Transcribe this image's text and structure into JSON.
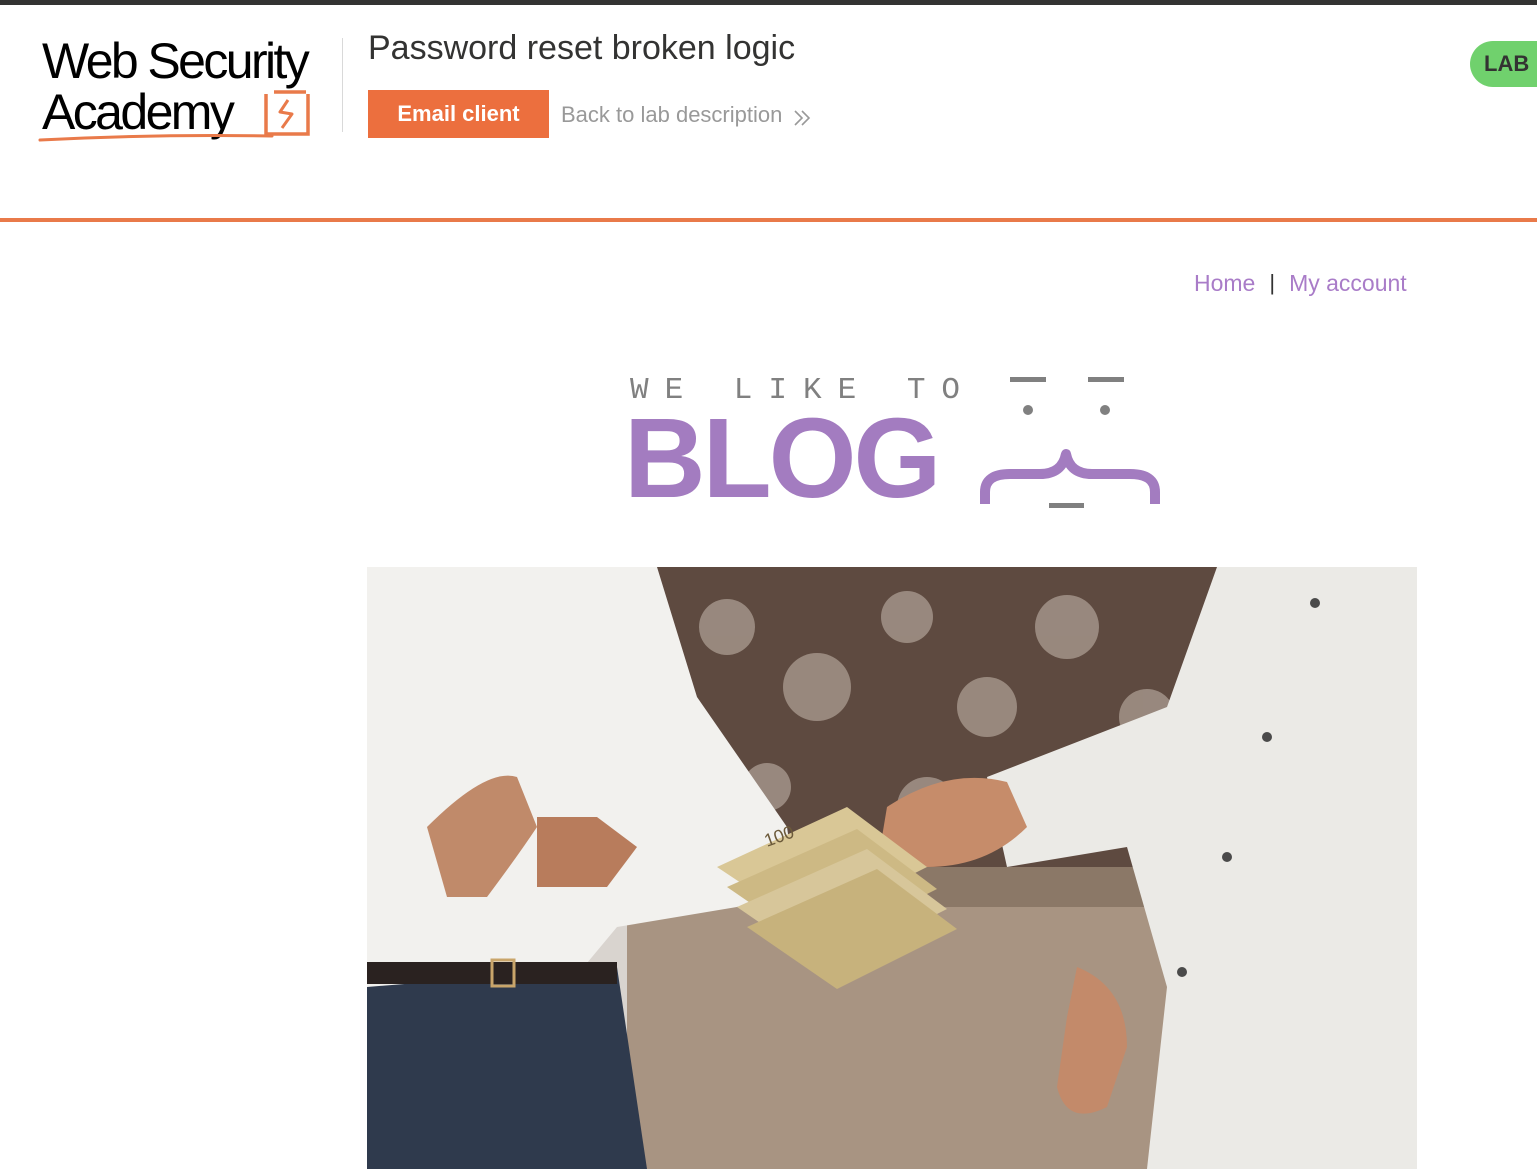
{
  "brand": {
    "line1": "Web Security",
    "line2": "Academy"
  },
  "lab": {
    "title": "Password reset broken logic",
    "email_client_label": "Email client",
    "back_link_label": "Back to lab description",
    "badge_label": "LAB"
  },
  "nav": {
    "home_label": "Home",
    "separator": "|",
    "my_account_label": "My account"
  },
  "blog_banner": {
    "tagline": "WE LIKE TO",
    "word": "BLOG"
  },
  "hero_image": {
    "alt": "Two men in white shirts exchanging a stack of banknotes"
  },
  "colors": {
    "accent_orange": "#ec6f3e",
    "lab_badge_green": "#70d16d",
    "nav_purple": "#a97cc8",
    "blog_purple": "#a37cc0"
  }
}
